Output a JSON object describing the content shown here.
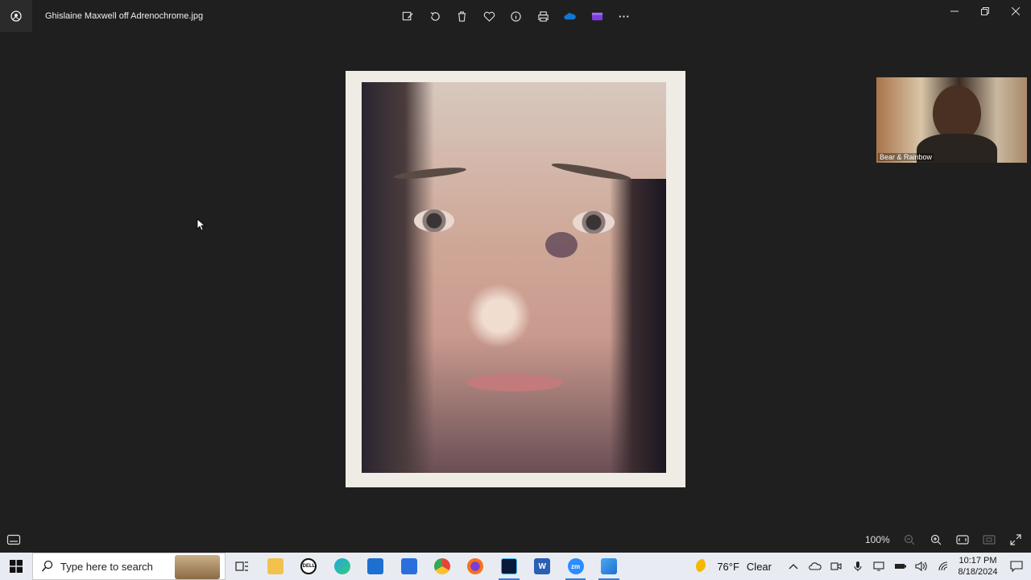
{
  "window": {
    "title": "Ghislaine Maxwell off Adrenochrome.jpg",
    "controls": [
      "minimize",
      "maximize",
      "close"
    ]
  },
  "toolbar": {
    "buttons": [
      {
        "name": "edit-image-button",
        "icon": "edit-icon"
      },
      {
        "name": "rotate-button",
        "icon": "rotate-icon"
      },
      {
        "name": "delete-button",
        "icon": "trash-icon"
      },
      {
        "name": "favorite-button",
        "icon": "heart-icon"
      },
      {
        "name": "info-button",
        "icon": "info-icon"
      },
      {
        "name": "print-button",
        "icon": "printer-icon"
      },
      {
        "name": "onedrive-button",
        "icon": "cloud-icon"
      },
      {
        "name": "clipchamp-button",
        "icon": "clipchamp-icon"
      },
      {
        "name": "more-button",
        "icon": "ellipsis-icon"
      }
    ]
  },
  "video_call": {
    "participant_label": "Bear & Rainbow"
  },
  "bottombar": {
    "zoom": "100%"
  },
  "taskbar": {
    "search_placeholder": "Type here to search",
    "weather": {
      "temp": "76°F",
      "condition": "Clear"
    },
    "clock": {
      "time": "10:17 PM",
      "date": "8/18/2024"
    }
  },
  "colors": {
    "app_bg": "#1f1f1f",
    "taskbar_bg": "#e8ecf2",
    "accent": "#3b7ed8"
  }
}
